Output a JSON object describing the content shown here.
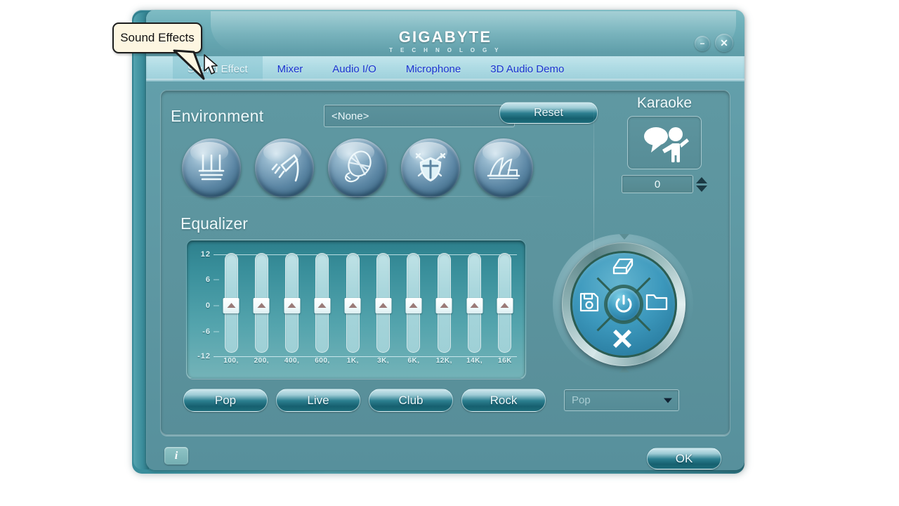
{
  "window": {
    "brand_name": "GIGABYTE",
    "brand_sub": "T E C H N O L O G Y",
    "minimize_label": "−",
    "close_label": "✕"
  },
  "callout": {
    "text": "Sound Effects"
  },
  "tabs": [
    {
      "label": "Sound Effect",
      "active": true
    },
    {
      "label": "Mixer",
      "active": false
    },
    {
      "label": "Audio I/O",
      "active": false
    },
    {
      "label": "Microphone",
      "active": false
    },
    {
      "label": "3D Audio Demo",
      "active": false
    }
  ],
  "environment": {
    "title": "Environment",
    "selected": "<None>",
    "reset_label": "Reset",
    "icons": [
      {
        "name": "bathroom-icon",
        "label": "Bathroom"
      },
      {
        "name": "shower-icon",
        "label": "Shower"
      },
      {
        "name": "stadium-icon",
        "label": "Stadium"
      },
      {
        "name": "armory-icon",
        "label": "Armory"
      },
      {
        "name": "concert-hall-icon",
        "label": "Concert Hall"
      }
    ]
  },
  "karaoke": {
    "title": "Karaoke",
    "value": "0",
    "icon_name": "karaoke-singer-icon"
  },
  "equalizer": {
    "title": "Equalizer",
    "y_labels": [
      "12",
      "6",
      "0",
      "-6",
      "-12"
    ],
    "bands": [
      {
        "label": "100,",
        "value": 0
      },
      {
        "label": "200,",
        "value": 0
      },
      {
        "label": "400,",
        "value": 0
      },
      {
        "label": "600,",
        "value": 0
      },
      {
        "label": "1K,",
        "value": 0
      },
      {
        "label": "3K,",
        "value": 0
      },
      {
        "label": "6K,",
        "value": 0
      },
      {
        "label": "12K,",
        "value": 0
      },
      {
        "label": "14K,",
        "value": 0
      },
      {
        "label": "16K",
        "value": 0
      }
    ]
  },
  "dpad": {
    "top_icon": "eraser-icon",
    "left_icon": "save-floppy-icon",
    "right_icon": "open-folder-icon",
    "bottom_icon": "delete-x-icon",
    "center_icon": "power-icon"
  },
  "presets": {
    "buttons": [
      "Pop",
      "Live",
      "Club",
      "Rock"
    ],
    "selected": "Pop"
  },
  "footer": {
    "info_label": "i",
    "ok_label": "OK"
  },
  "colors": {
    "panel_bg": "#5f98a2",
    "window_bg": "#63a0ac",
    "tab_bar": "#aedbe4",
    "tab_link": "#1a33cf",
    "eq_track": "#a8d6dc",
    "accent_button": "#16606f",
    "callout_bg": "#fdf6e1"
  }
}
